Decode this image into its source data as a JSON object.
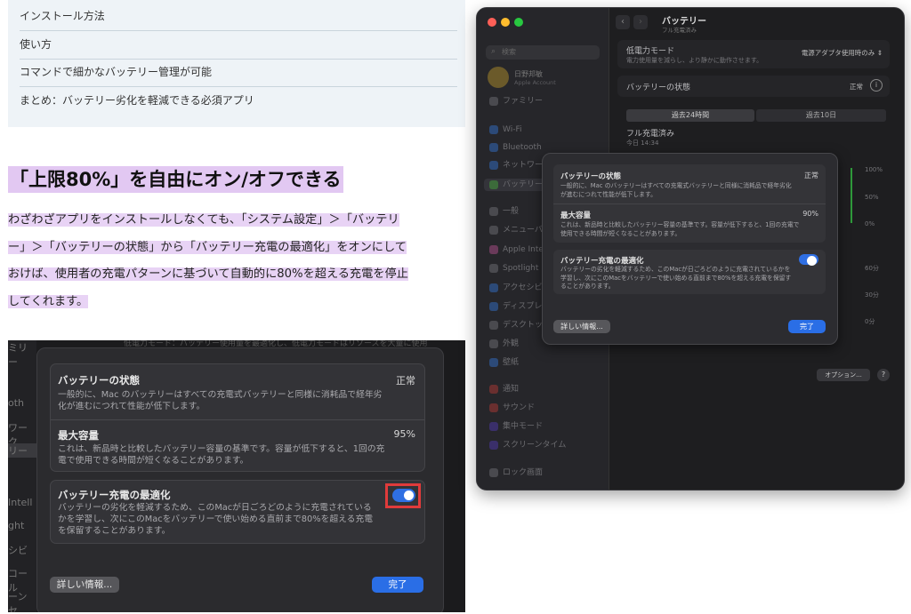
{
  "toc": {
    "items": [
      "インストール方法",
      "使い方",
      "コマンドで細かなバッテリー管理が可能",
      "まとめ：バッテリー劣化を軽減できる必須アプリ"
    ]
  },
  "article": {
    "heading": "「上限80%」を自由にオン/オフできる",
    "lines": [
      "わざわざアプリをインストールしなくても、「システム設定」＞「バッテリ",
      "ー」＞「バッテリーの状態」から「バッテリー充電の最適化」をオンにして",
      "おけば、使用者の充電パターンに基づいて自動的に80%を超える充電を停止",
      "してくれます。"
    ]
  },
  "crop": {
    "sidebar_fragments": [
      "ミリー",
      "oth",
      "ワーク",
      "リー",
      "Intell",
      "ght",
      "シビ",
      "コール",
      "ーンセ"
    ],
    "top_fragment": "低電力モード：バッテリー使用量を最適化し、低電力モードはリソースを大量に使用",
    "health_title": "バッテリーの状態",
    "health_value": "正常",
    "health_desc": "一般的に、Mac のバッテリーはすべての充電式バッテリーと同様に消耗品で経年劣化が進むにつれて性能が低下します。",
    "capacity_title": "最大容量",
    "capacity_value": "95%",
    "capacity_desc": "これは、新品時と比較したバッテリー容量の基準です。容量が低下すると、1回の充電で使用できる時間が短くなることがあります。",
    "optimize_title": "バッテリー充電の最適化",
    "optimize_desc": "バッテリーの劣化を軽減するため、このMacが日ごろどのように充電されているかを学習し、次にこのMacをバッテリーで使い始める直前まで80%を超える充電を保留することがあります。",
    "optimize_on": true,
    "details_button": "詳しい情報...",
    "done_button": "完了",
    "highlight_color": "#e03b3b"
  },
  "window": {
    "title": "バッテリー",
    "subtitle": "フル充電済み",
    "search_placeholder": "検索",
    "user_name": "日野邦敏",
    "user_sub": "Apple Account",
    "sidebar_items": [
      "ファミリー",
      "Wi-Fi",
      "Bluetooth",
      "ネットワーク",
      "バッテリー",
      "一般",
      "メニューバー",
      "Apple Intelligence",
      "Spotlight",
      "アクセシビリティ",
      "ディスプレイ",
      "デスクトップ",
      "外観",
      "壁紙",
      "通知",
      "サウンド",
      "集中モード",
      "スクリーンタイム",
      "ロック画面"
    ],
    "low_power_label": "低電力モード",
    "low_power_desc": "電力使用量を減らし、より静かに動作させます。",
    "low_power_value": "電源アダプタ使用時のみ",
    "health_label": "バッテリーの状態",
    "health_value": "正常",
    "tab_24h": "過去24時間",
    "tab_10d": "過去10日",
    "charge_status": "フル充電済み",
    "charge_time": "今日 14:34",
    "y_labels": [
      "100%",
      "50%",
      "0%"
    ],
    "y_labels2": [
      "60分",
      "30分",
      "0分"
    ],
    "options_button": "オプション...",
    "help_button": "?"
  },
  "popup": {
    "health_title": "バッテリーの状態",
    "health_value": "正常",
    "health_desc": "一般的に、Mac のバッテリーはすべての充電式バッテリーと同様に消耗品で経年劣化が進むにつれて性能が低下します。",
    "capacity_title": "最大容量",
    "capacity_value": "90%",
    "capacity_desc": "これは、新品時と比較したバッテリー容量の基準です。容量が低下すると、1回の充電で使用できる時間が短くなることがあります。",
    "optimize_title": "バッテリー充電の最適化",
    "optimize_desc": "バッテリーの劣化を軽減するため、このMacが日ごろどのように充電されているかを学習し、次にこのMacをバッテリーで使い始める直前まで80%を超える充電を保留することがあります。",
    "details_button": "詳しい情報...",
    "done_button": "完了"
  }
}
